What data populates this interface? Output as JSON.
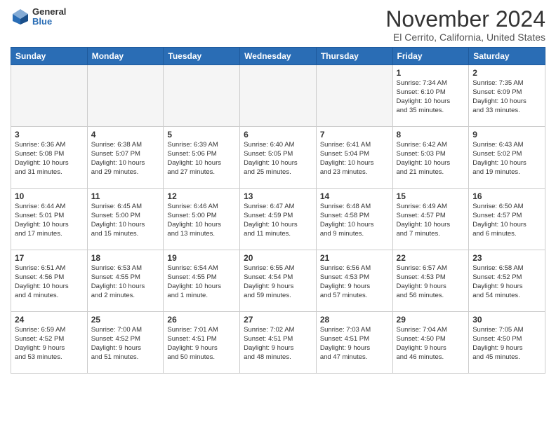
{
  "header": {
    "logo_general": "General",
    "logo_blue": "Blue",
    "month_title": "November 2024",
    "location": "El Cerrito, California, United States"
  },
  "days_of_week": [
    "Sunday",
    "Monday",
    "Tuesday",
    "Wednesday",
    "Thursday",
    "Friday",
    "Saturday"
  ],
  "weeks": [
    [
      {
        "day": "",
        "info": ""
      },
      {
        "day": "",
        "info": ""
      },
      {
        "day": "",
        "info": ""
      },
      {
        "day": "",
        "info": ""
      },
      {
        "day": "",
        "info": ""
      },
      {
        "day": "1",
        "info": "Sunrise: 7:34 AM\nSunset: 6:10 PM\nDaylight: 10 hours\nand 35 minutes."
      },
      {
        "day": "2",
        "info": "Sunrise: 7:35 AM\nSunset: 6:09 PM\nDaylight: 10 hours\nand 33 minutes."
      }
    ],
    [
      {
        "day": "3",
        "info": "Sunrise: 6:36 AM\nSunset: 5:08 PM\nDaylight: 10 hours\nand 31 minutes."
      },
      {
        "day": "4",
        "info": "Sunrise: 6:38 AM\nSunset: 5:07 PM\nDaylight: 10 hours\nand 29 minutes."
      },
      {
        "day": "5",
        "info": "Sunrise: 6:39 AM\nSunset: 5:06 PM\nDaylight: 10 hours\nand 27 minutes."
      },
      {
        "day": "6",
        "info": "Sunrise: 6:40 AM\nSunset: 5:05 PM\nDaylight: 10 hours\nand 25 minutes."
      },
      {
        "day": "7",
        "info": "Sunrise: 6:41 AM\nSunset: 5:04 PM\nDaylight: 10 hours\nand 23 minutes."
      },
      {
        "day": "8",
        "info": "Sunrise: 6:42 AM\nSunset: 5:03 PM\nDaylight: 10 hours\nand 21 minutes."
      },
      {
        "day": "9",
        "info": "Sunrise: 6:43 AM\nSunset: 5:02 PM\nDaylight: 10 hours\nand 19 minutes."
      }
    ],
    [
      {
        "day": "10",
        "info": "Sunrise: 6:44 AM\nSunset: 5:01 PM\nDaylight: 10 hours\nand 17 minutes."
      },
      {
        "day": "11",
        "info": "Sunrise: 6:45 AM\nSunset: 5:00 PM\nDaylight: 10 hours\nand 15 minutes."
      },
      {
        "day": "12",
        "info": "Sunrise: 6:46 AM\nSunset: 5:00 PM\nDaylight: 10 hours\nand 13 minutes."
      },
      {
        "day": "13",
        "info": "Sunrise: 6:47 AM\nSunset: 4:59 PM\nDaylight: 10 hours\nand 11 minutes."
      },
      {
        "day": "14",
        "info": "Sunrise: 6:48 AM\nSunset: 4:58 PM\nDaylight: 10 hours\nand 9 minutes."
      },
      {
        "day": "15",
        "info": "Sunrise: 6:49 AM\nSunset: 4:57 PM\nDaylight: 10 hours\nand 7 minutes."
      },
      {
        "day": "16",
        "info": "Sunrise: 6:50 AM\nSunset: 4:57 PM\nDaylight: 10 hours\nand 6 minutes."
      }
    ],
    [
      {
        "day": "17",
        "info": "Sunrise: 6:51 AM\nSunset: 4:56 PM\nDaylight: 10 hours\nand 4 minutes."
      },
      {
        "day": "18",
        "info": "Sunrise: 6:53 AM\nSunset: 4:55 PM\nDaylight: 10 hours\nand 2 minutes."
      },
      {
        "day": "19",
        "info": "Sunrise: 6:54 AM\nSunset: 4:55 PM\nDaylight: 10 hours\nand 1 minute."
      },
      {
        "day": "20",
        "info": "Sunrise: 6:55 AM\nSunset: 4:54 PM\nDaylight: 9 hours\nand 59 minutes."
      },
      {
        "day": "21",
        "info": "Sunrise: 6:56 AM\nSunset: 4:53 PM\nDaylight: 9 hours\nand 57 minutes."
      },
      {
        "day": "22",
        "info": "Sunrise: 6:57 AM\nSunset: 4:53 PM\nDaylight: 9 hours\nand 56 minutes."
      },
      {
        "day": "23",
        "info": "Sunrise: 6:58 AM\nSunset: 4:52 PM\nDaylight: 9 hours\nand 54 minutes."
      }
    ],
    [
      {
        "day": "24",
        "info": "Sunrise: 6:59 AM\nSunset: 4:52 PM\nDaylight: 9 hours\nand 53 minutes."
      },
      {
        "day": "25",
        "info": "Sunrise: 7:00 AM\nSunset: 4:52 PM\nDaylight: 9 hours\nand 51 minutes."
      },
      {
        "day": "26",
        "info": "Sunrise: 7:01 AM\nSunset: 4:51 PM\nDaylight: 9 hours\nand 50 minutes."
      },
      {
        "day": "27",
        "info": "Sunrise: 7:02 AM\nSunset: 4:51 PM\nDaylight: 9 hours\nand 48 minutes."
      },
      {
        "day": "28",
        "info": "Sunrise: 7:03 AM\nSunset: 4:51 PM\nDaylight: 9 hours\nand 47 minutes."
      },
      {
        "day": "29",
        "info": "Sunrise: 7:04 AM\nSunset: 4:50 PM\nDaylight: 9 hours\nand 46 minutes."
      },
      {
        "day": "30",
        "info": "Sunrise: 7:05 AM\nSunset: 4:50 PM\nDaylight: 9 hours\nand 45 minutes."
      }
    ]
  ]
}
